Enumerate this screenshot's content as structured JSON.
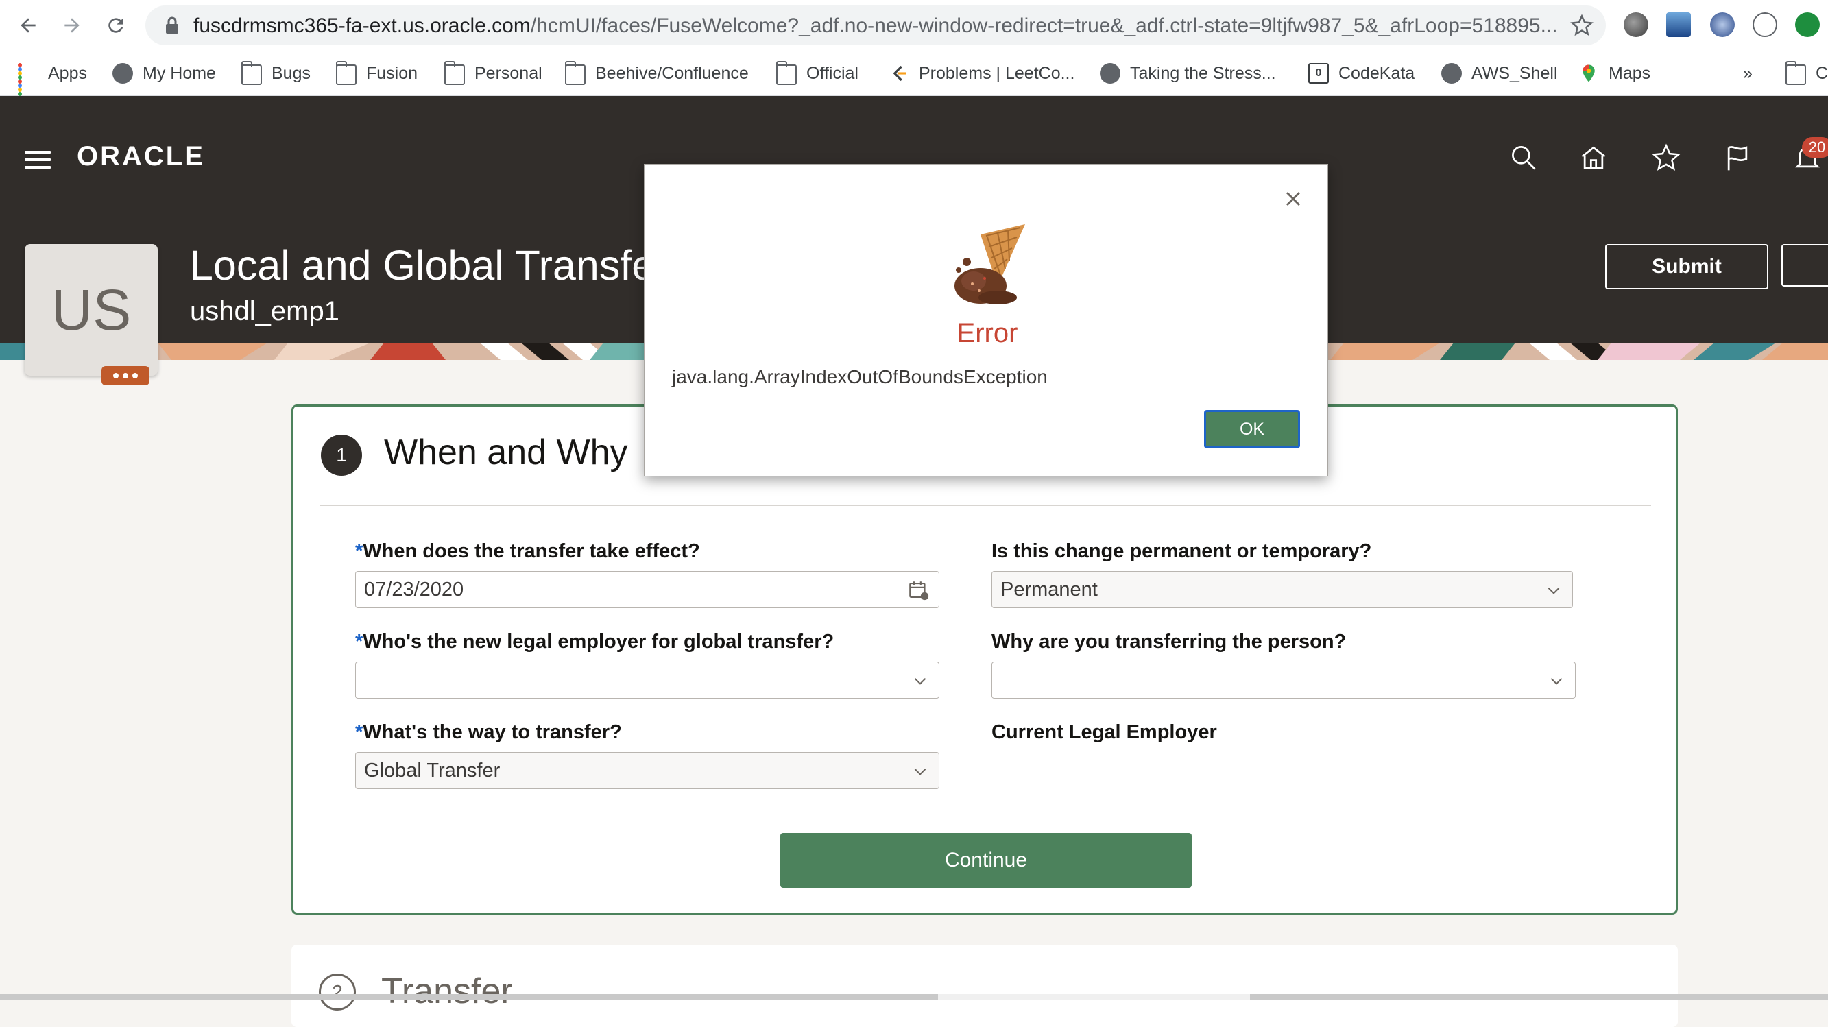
{
  "browser": {
    "url_host": "fuscdrmsmc365-fa-ext.us.oracle.com",
    "url_path": "/hcmUI/faces/FuseWelcome?_adf.no-new-window-redirect=true&_adf.ctrl-state=9ltjfw987_5&_afrLoop=518895...",
    "bookmarks": [
      {
        "label": "Apps",
        "icon": "apps-grid-icon"
      },
      {
        "label": "My Home",
        "icon": "globe-icon"
      },
      {
        "label": "Bugs",
        "icon": "folder-icon"
      },
      {
        "label": "Fusion",
        "icon": "folder-icon"
      },
      {
        "label": "Personal",
        "icon": "folder-icon"
      },
      {
        "label": "Beehive/Confluence",
        "icon": "folder-icon"
      },
      {
        "label": "Official",
        "icon": "folder-icon"
      },
      {
        "label": "Problems | LeetCo...",
        "icon": "leetcode-icon"
      },
      {
        "label": "Taking the Stress...",
        "icon": "globe-icon"
      },
      {
        "label": "CodeKata",
        "icon": "codekata-icon"
      },
      {
        "label": "AWS_Shell",
        "icon": "globe-icon"
      },
      {
        "label": "Maps",
        "icon": "maps-pin-icon"
      }
    ],
    "overflow_label": "»",
    "trailing_folder_label": "C"
  },
  "app": {
    "logo_text": "ORACLE",
    "notification_count": "20",
    "avatar_initials": "US",
    "page_title": "Local and Global Transfer",
    "person_name": "ushdl_emp1",
    "submit_label": "Submit",
    "accent_color": "#4c825c",
    "error_color": "#c74634"
  },
  "section1": {
    "step_number": "1",
    "title": "When and Why",
    "fields": {
      "effective_date": {
        "label": "When does the transfer take effect?",
        "required": "*",
        "value": "07/23/2020"
      },
      "permanent_temporary": {
        "label": "Is this change permanent or temporary?",
        "value": "Permanent"
      },
      "legal_employer": {
        "label": "Who's the new legal employer for global transfer?",
        "required": "*",
        "value": ""
      },
      "reason": {
        "label": "Why are you transferring the person?",
        "value": ""
      },
      "transfer_way": {
        "label": "What's the way to transfer?",
        "required": "*",
        "value": "Global Transfer"
      },
      "current_employer": {
        "label": "Current Legal Employer"
      }
    },
    "continue_label": "Continue"
  },
  "section2": {
    "step_number": "2",
    "title": "Transfer"
  },
  "dialog": {
    "title": "Error",
    "message": "java.lang.ArrayIndexOutOfBoundsException",
    "ok_label": "OK",
    "icon": "dropped-ice-cream-icon"
  }
}
